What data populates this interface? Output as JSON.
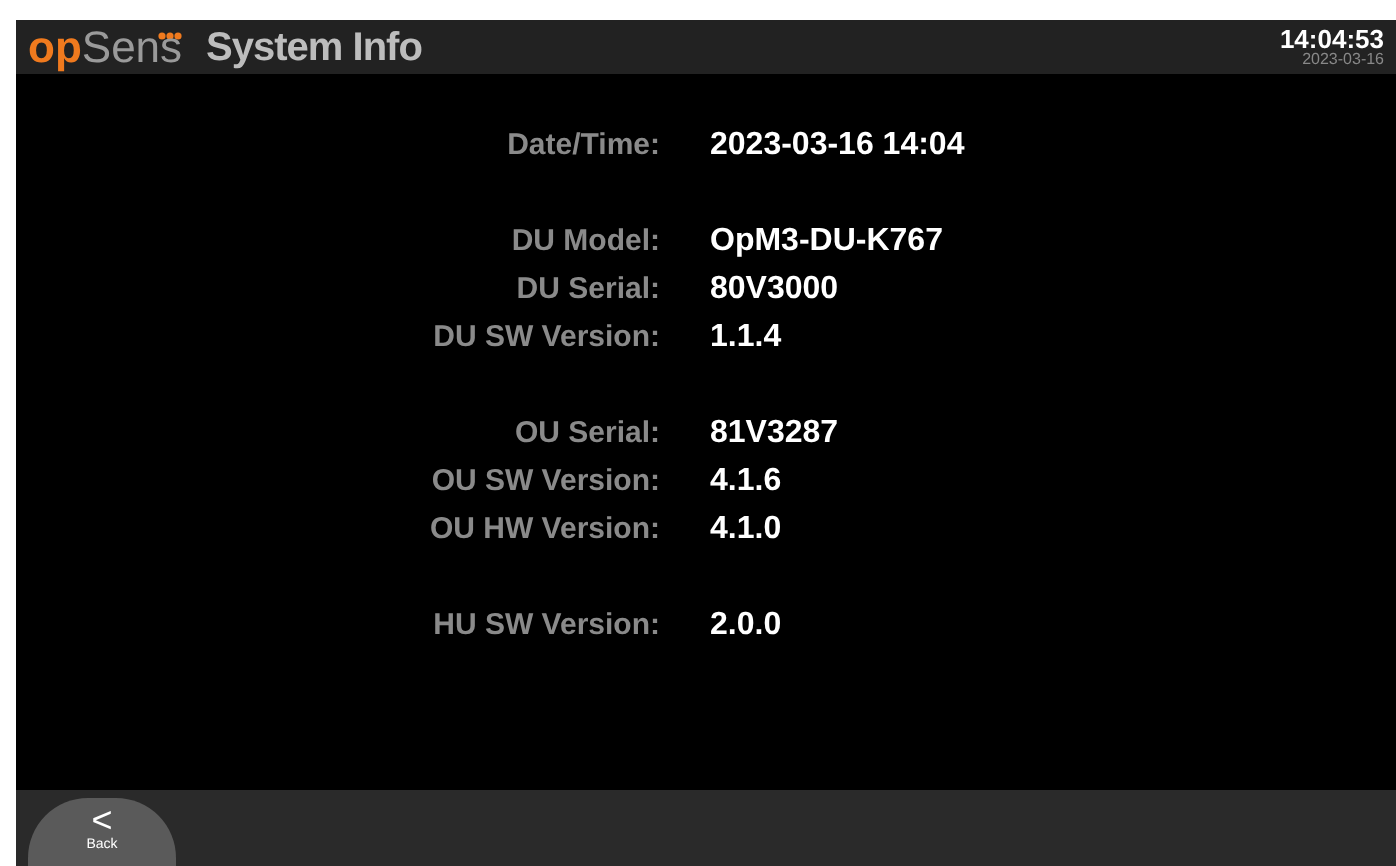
{
  "header": {
    "logo": {
      "accent": "op",
      "rest": "Sens"
    },
    "title": "System Info",
    "clock": {
      "time": "14:04:53",
      "date": "2023-03-16"
    }
  },
  "groups": [
    {
      "rows": [
        {
          "label": "Date/Time:",
          "value": "2023-03-16  14:04"
        }
      ]
    },
    {
      "rows": [
        {
          "label": "DU Model:",
          "value": "OpM3-DU-K767"
        },
        {
          "label": "DU Serial:",
          "value": "80V3000"
        },
        {
          "label": "DU SW Version:",
          "value": "1.1.4"
        }
      ]
    },
    {
      "rows": [
        {
          "label": "OU Serial:",
          "value": "81V3287"
        },
        {
          "label": "OU SW Version:",
          "value": "4.1.6"
        },
        {
          "label": "OU HW Version:",
          "value": "4.1.0"
        }
      ]
    },
    {
      "rows": [
        {
          "label": "HU SW Version:",
          "value": "2.0.0"
        }
      ]
    }
  ],
  "footer": {
    "back": {
      "icon": "<",
      "label": "Back"
    }
  }
}
